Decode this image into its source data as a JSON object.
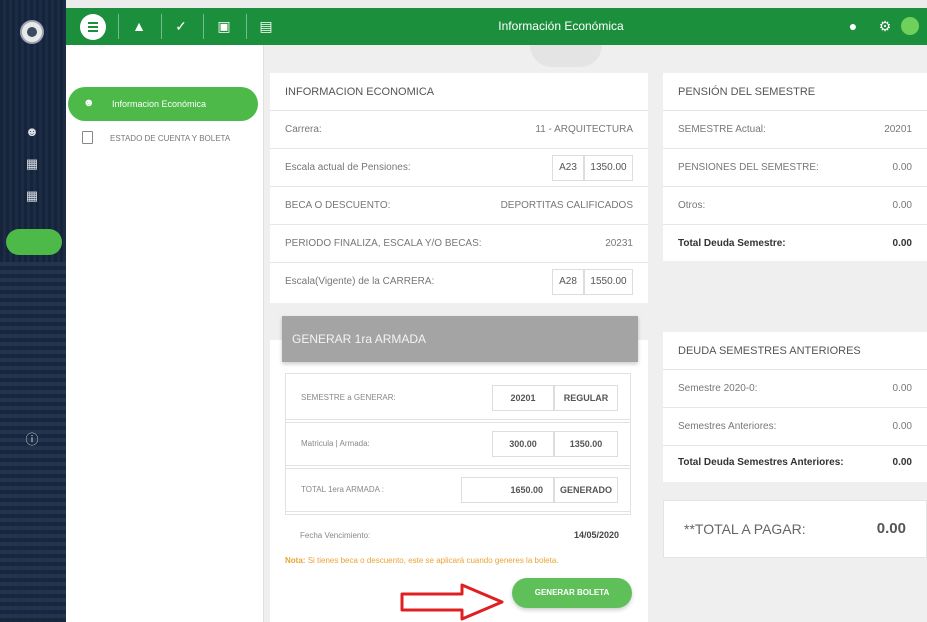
{
  "topbar": {
    "title": "Información Económica",
    "icons": [
      "menu-icon",
      "graduation-cap-icon",
      "check-icon",
      "calendar-icon",
      "card-icon",
      "bell-icon",
      "gear-icon"
    ]
  },
  "sidebar": {
    "items": [
      {
        "label": "Informacion Económica",
        "icon": "user-icon",
        "active": true
      },
      {
        "label": "ESTADO DE CUENTA Y BOLETA",
        "icon": "document-icon",
        "active": false
      }
    ]
  },
  "info_economica": {
    "title": "INFORMACION ECONOMICA",
    "rows": [
      {
        "label": "Carrera:",
        "value": "11 - ARQUITECTURA"
      },
      {
        "label": "Escala actual de Pensiones:",
        "code": "A23",
        "amount": "1350.00"
      },
      {
        "label": "BECA O DESCUENTO:",
        "value": "DEPORTITAS CALIFICADOS"
      },
      {
        "label": "PERIODO FINALIZA, ESCALA Y/O BECAS:",
        "value": "20231"
      },
      {
        "label": "Escala(Vigente) de la CARRERA:",
        "code": "A28",
        "amount": "1550.00"
      }
    ]
  },
  "pension_semestre": {
    "title": "PENSIÓN DEL SEMESTRE",
    "rows": [
      {
        "label": "SEMESTRE Actual:",
        "value": "20201"
      },
      {
        "label": "PENSIONES DEL SEMESTRE:",
        "value": "0.00"
      },
      {
        "label": "Otros:",
        "value": "0.00"
      },
      {
        "label": "Total Deuda Semestre:",
        "value": "0.00"
      }
    ]
  },
  "generar": {
    "title": "GENERAR 1ra ARMADA",
    "semestre_label": "SEMESTRE a GENERAR:",
    "semestre_value": "20201",
    "semestre_tipo": "REGULAR",
    "matricula_label": "Matricula | Armada:",
    "matricula_value": "300.00",
    "armada_value": "1350.00",
    "total_label": "TOTAL 1era ARMADA :",
    "total_value": "1650.00",
    "total_status": "GENERADO",
    "fecha_label": "Fecha Vencimiento:",
    "fecha_value": "14/05/2020",
    "note_prefix": "Nota:",
    "note_text": "Si tienes beca o descuento, este se aplicará cuando generes la boleta.",
    "button_label": "GENERAR BOLETA"
  },
  "deuda_anteriores": {
    "title": "DEUDA SEMESTRES ANTERIORES",
    "rows": [
      {
        "label": "Semestre 2020-0:",
        "value": "0.00"
      },
      {
        "label": "Semestres Anteriores:",
        "value": "0.00"
      },
      {
        "label": "Total Deuda Semestres Anteriores:",
        "value": "0.00"
      }
    ]
  },
  "total_pagar": {
    "label": "**TOTAL A PAGAR:",
    "value": "0.00"
  },
  "colors": {
    "brand_green": "#1c8f3d",
    "accent_green": "#4cb949",
    "note_orange": "#e9a436",
    "arrow_red": "#e02020"
  }
}
